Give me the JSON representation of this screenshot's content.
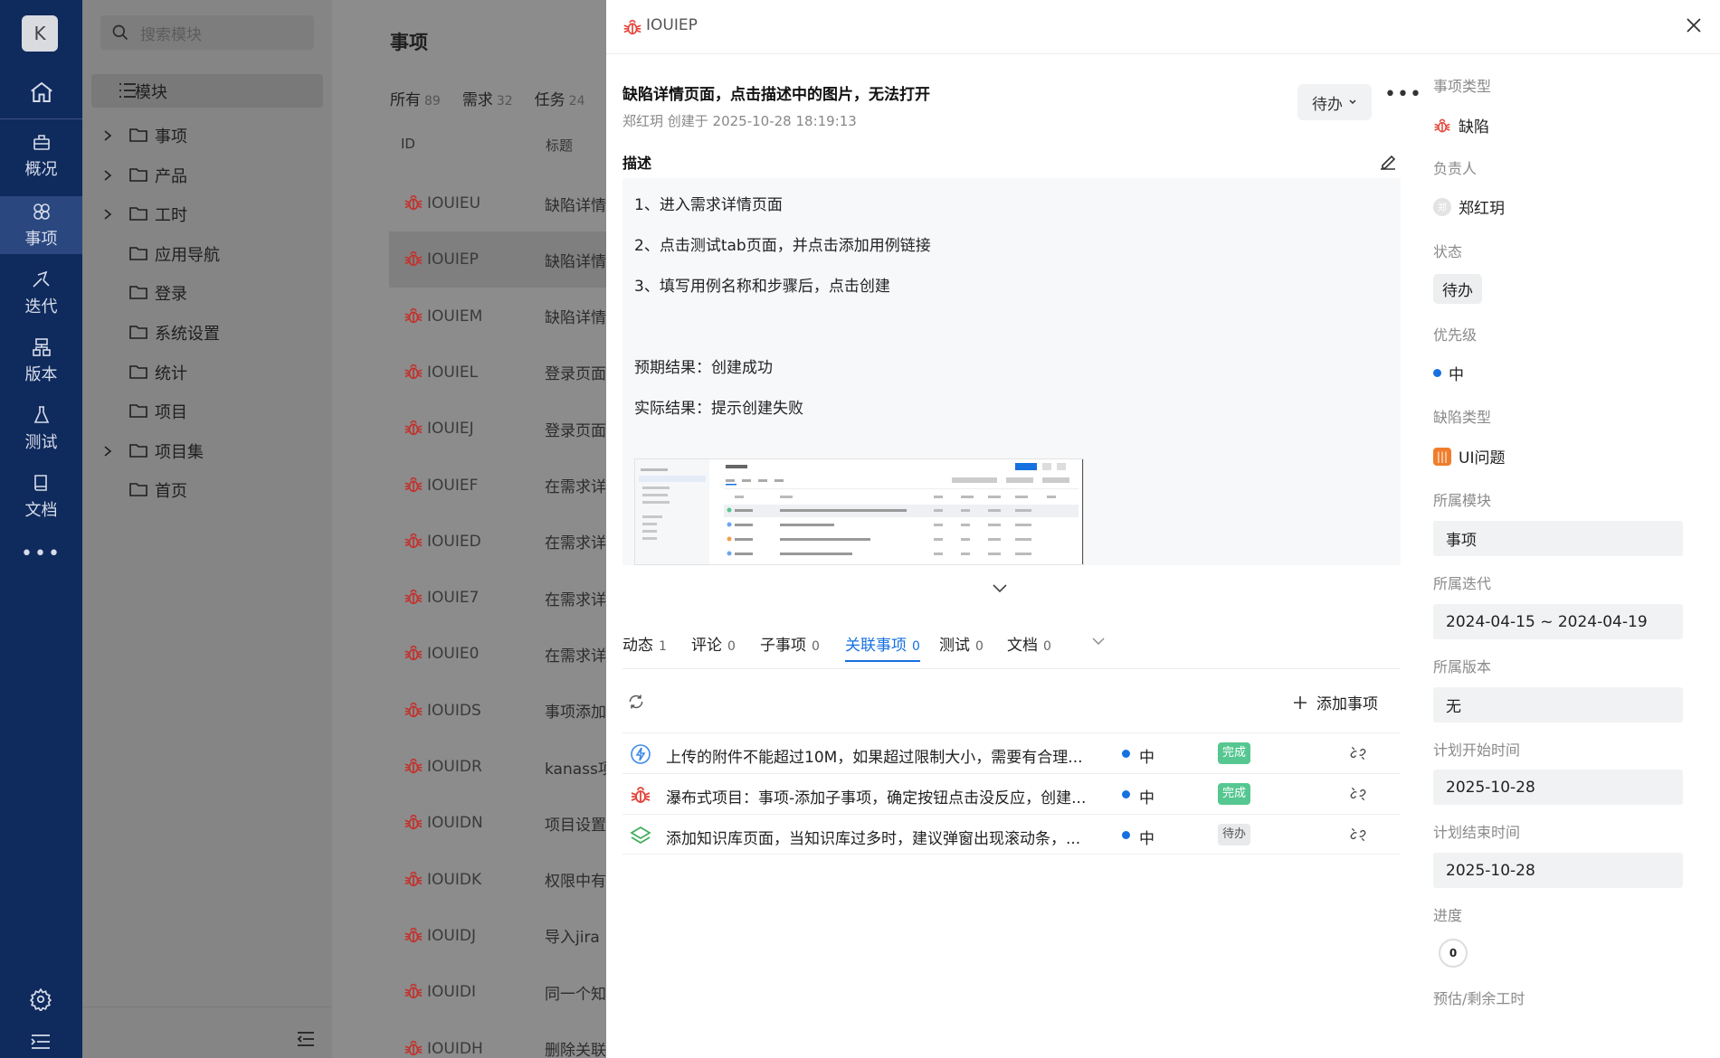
{
  "app": {
    "avatar_letter": "K"
  },
  "nav": [
    {
      "label": "概况",
      "icon": "overview-icon"
    },
    {
      "label": "事项",
      "icon": "workitem-icon"
    },
    {
      "label": "迭代",
      "icon": "sprint-icon"
    },
    {
      "label": "版本",
      "icon": "version-icon"
    },
    {
      "label": "测试",
      "icon": "test-icon"
    },
    {
      "label": "文档",
      "icon": "doc-icon"
    }
  ],
  "tree": {
    "search_placeholder": "搜索模块",
    "root": "模块",
    "nodes": [
      {
        "label": "事项",
        "expandable": true
      },
      {
        "label": "产品",
        "expandable": true
      },
      {
        "label": "工时",
        "expandable": true
      },
      {
        "label": "应用导航",
        "expandable": false
      },
      {
        "label": "登录",
        "expandable": false
      },
      {
        "label": "系统设置",
        "expandable": false
      },
      {
        "label": "统计",
        "expandable": false
      },
      {
        "label": "项目",
        "expandable": false
      },
      {
        "label": "项目集",
        "expandable": true
      },
      {
        "label": "首页",
        "expandable": false
      }
    ]
  },
  "list": {
    "title": "事项",
    "tabs": [
      {
        "label": "所有",
        "count": "89"
      },
      {
        "label": "需求",
        "count": "32"
      },
      {
        "label": "任务",
        "count": "24"
      }
    ],
    "col_id": "ID",
    "col_title": "标题",
    "rows": [
      {
        "id": "IOUIEU",
        "title": "缺陷详情"
      },
      {
        "id": "IOUIEP",
        "title": "缺陷详情"
      },
      {
        "id": "IOUIEM",
        "title": "缺陷详情"
      },
      {
        "id": "IOUIEL",
        "title": "登录页面"
      },
      {
        "id": "IOUIEJ",
        "title": "登录页面"
      },
      {
        "id": "IOUIEF",
        "title": "在需求详"
      },
      {
        "id": "IOUIED",
        "title": "在需求详"
      },
      {
        "id": "IOUIE7",
        "title": "在需求详"
      },
      {
        "id": "IOUIE0",
        "title": "在需求详"
      },
      {
        "id": "IOUIDS",
        "title": "事项添加"
      },
      {
        "id": "IOUIDR",
        "title": "kanass项"
      },
      {
        "id": "IOUIDN",
        "title": "项目设置"
      },
      {
        "id": "IOUIDK",
        "title": "权限中有"
      },
      {
        "id": "IOUIDJ",
        "title": "导入jira"
      },
      {
        "id": "IOUIDI",
        "title": "同一个知"
      },
      {
        "id": "IOUIDH",
        "title": "删除关联"
      }
    ]
  },
  "drawer": {
    "code": "IOUIEP",
    "title": "缺陷详情页面，点击描述中的图片，无法打开",
    "meta": "郑红玥 创建于 2025-10-28 18:19:13",
    "status": "待办",
    "desc_label": "描述",
    "desc_lines": [
      "1、进入需求详情页面",
      "2、点击测试tab页面，并点击添加用例链接",
      "3、填写用例名称和步骤后，点击创建",
      "预期结果：创建成功",
      "实际结果：提示创建失败"
    ],
    "tabs": [
      {
        "label": "动态",
        "count": "1"
      },
      {
        "label": "评论",
        "count": "0"
      },
      {
        "label": "子事项",
        "count": "0"
      },
      {
        "label": "关联事项",
        "count": "0"
      },
      {
        "label": "测试",
        "count": "0"
      },
      {
        "label": "文档",
        "count": "0"
      }
    ],
    "add_label": "添加事项",
    "related": [
      {
        "type": "task",
        "title": "上传的附件不能超过10M，如果超过限制大小，需要有合理...",
        "priority": "中",
        "status": "完成"
      },
      {
        "type": "bug",
        "title": "瀑布式项目：事项-添加子事项，确定按钮点击没反应，创建...",
        "priority": "中",
        "status": "完成"
      },
      {
        "type": "req",
        "title": "添加知识库页面，当知识库过多时，建议弹窗出现滚动条，...",
        "priority": "中",
        "status": "待办"
      }
    ]
  },
  "props": {
    "type_label": "事项类型",
    "type_value": "缺陷",
    "owner_label": "负责人",
    "owner_value": "郑红玥",
    "owner_avatar": "郑",
    "status_label": "状态",
    "status_value": "待办",
    "priority_label": "优先级",
    "priority_value": "中",
    "bugtype_label": "缺陷类型",
    "bugtype_value": "UI问题",
    "module_label": "所属模块",
    "module_value": "事项",
    "sprint_label": "所属迭代",
    "sprint_value": "2024-04-15 ~ 2024-04-19",
    "version_label": "所属版本",
    "version_value": "无",
    "start_label": "计划开始时间",
    "start_value": "2025-10-28",
    "end_label": "计划结束时间",
    "end_value": "2025-10-28",
    "progress_label": "进度",
    "progress_value": "0",
    "estimate_label": "预估/剩余工时"
  },
  "colors": {
    "nav_bg": "#0f2a5c",
    "accent": "#1670e0",
    "bug": "#e4443a",
    "done": "#56c791"
  }
}
